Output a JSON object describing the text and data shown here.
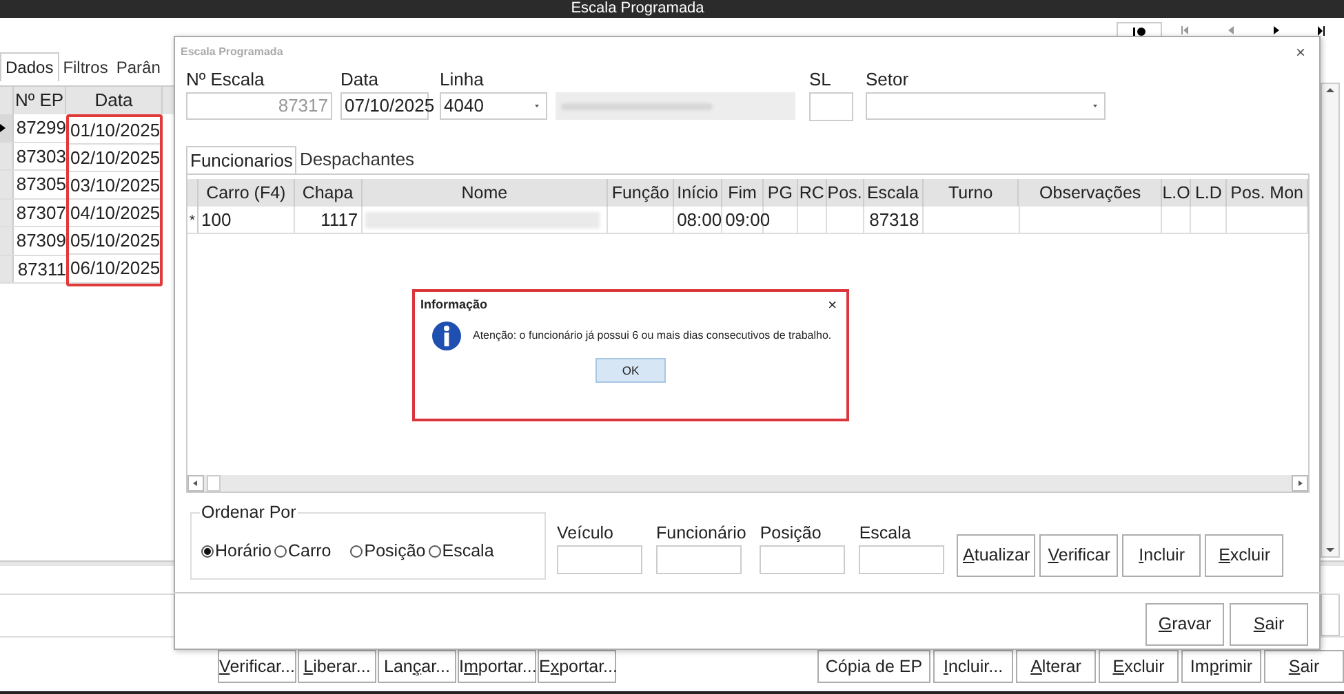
{
  "main_window": {
    "title": "Escala Programada"
  },
  "nav_buttons": [
    {
      "kind": "record"
    },
    {
      "kind": "first"
    },
    {
      "kind": "prev"
    },
    {
      "kind": "next"
    },
    {
      "kind": "last"
    }
  ],
  "left_tabs": [
    {
      "label": "Dados",
      "selected": true
    },
    {
      "label": "Filtros",
      "selected": false
    },
    {
      "label": "Parân",
      "selected": false
    }
  ],
  "left_grid": {
    "columns": [
      "Nº EP",
      "Data"
    ],
    "rows": [
      {
        "ep": "87299",
        "data": "01/10/2025",
        "selected": true
      },
      {
        "ep": "87303",
        "data": "02/10/2025",
        "selected": false
      },
      {
        "ep": "87305",
        "data": "03/10/2025",
        "selected": false
      },
      {
        "ep": "87307",
        "data": "04/10/2025",
        "selected": false
      },
      {
        "ep": "87309",
        "data": "05/10/2025",
        "selected": false
      },
      {
        "ep": "87311",
        "data": "06/10/2025",
        "selected": false
      }
    ]
  },
  "bottom_buttons_left": [
    {
      "key": "V",
      "post": "erificar..."
    },
    {
      "key": "L",
      "post": "iberar..."
    },
    {
      "pre": "Lan",
      "key": "ç",
      "post": "ar..."
    },
    {
      "pre": "I",
      "key": "m",
      "post": "portar..."
    },
    {
      "pre": "E",
      "key": "x",
      "post": "portar..."
    }
  ],
  "bottom_buttons_right": [
    {
      "pre": "Cópia de EP"
    },
    {
      "key": "I",
      "post": "ncluir..."
    },
    {
      "key": "A",
      "post": "lterar"
    },
    {
      "key": "E",
      "post": "xcluir"
    },
    {
      "pre": "Im",
      "key": "p",
      "post": "rimir"
    },
    {
      "key": "S",
      "post": "air"
    }
  ],
  "dialog": {
    "title": "Escala Programada",
    "close": "×",
    "fields": [
      {
        "kind": "text",
        "label": "Nº Escala",
        "value": "87317",
        "disabled": true
      },
      {
        "kind": "text",
        "label": "Data",
        "value": "07/10/2025",
        "disabled": false
      },
      {
        "kind": "combo",
        "label": "Linha",
        "value": "4040",
        "disabled": false
      },
      {
        "kind": "blurred"
      },
      {
        "kind": "small",
        "label": "SL",
        "disabled": false
      },
      {
        "kind": "combo",
        "label": "Setor",
        "disabled": false
      }
    ],
    "tabs": [
      {
        "label": "Funcionarios",
        "selected": true
      },
      {
        "label": "Despachantes",
        "selected": false
      }
    ],
    "table": {
      "columns": [
        "Carro (F4)",
        "Chapa",
        "Nome",
        "Função",
        "Início",
        "Fim",
        "PG",
        "RC",
        "Pos.",
        "Escala",
        "Turno",
        "Observações",
        "L.O",
        "L.D",
        "Pos. Mon"
      ],
      "rows": [
        {
          "marker": "*",
          "cells": [
            {
              "kind": "text",
              "text": "100"
            },
            {
              "kind": "number",
              "text": "1117"
            },
            {
              "kind": "blurred"
            },
            {
              "kind": "empty"
            },
            {
              "kind": "text",
              "text": "08:00"
            },
            {
              "kind": "text",
              "text": "09:00"
            },
            {
              "kind": "empty"
            },
            {
              "kind": "empty"
            },
            {
              "kind": "empty"
            },
            {
              "kind": "number",
              "text": "87318"
            },
            {
              "kind": "empty"
            },
            {
              "kind": "empty"
            },
            {
              "kind": "empty"
            },
            {
              "kind": "empty"
            },
            {
              "kind": "empty"
            }
          ]
        }
      ]
    },
    "order_by": {
      "title": "Ordenar Por",
      "options": [
        {
          "label": "Horário",
          "selected": true
        },
        {
          "label": "Carro",
          "selected": false
        },
        {
          "label": "Posição",
          "selected": false
        },
        {
          "label": "Escala",
          "selected": false
        }
      ]
    },
    "filters": [
      "Veículo",
      "Funcionário",
      "Posição",
      "Escala"
    ],
    "actions": [
      {
        "key": "A",
        "post": "tualizar"
      },
      {
        "key": "V",
        "post": "erificar"
      },
      {
        "key": "I",
        "post": "ncluir"
      },
      {
        "key": "E",
        "post": "xcluir"
      }
    ],
    "footer_buttons": [
      {
        "key": "G",
        "post": "ravar"
      },
      {
        "key": "S",
        "post": "air"
      }
    ]
  },
  "message_box": {
    "title": "Informação",
    "close": "×",
    "text": "Atenção: o funcionário já possui 6 ou mais dias consecutivos de trabalho.",
    "button": "OK"
  }
}
